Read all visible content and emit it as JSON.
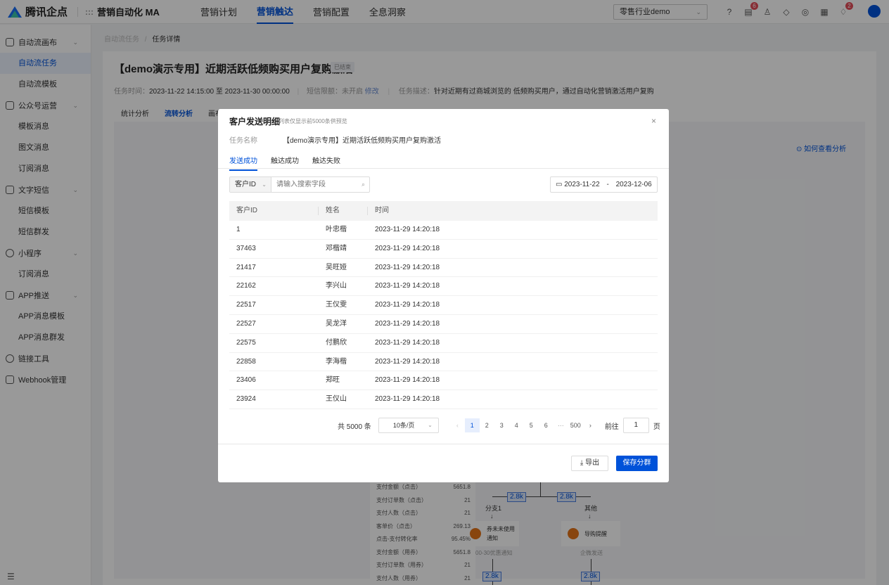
{
  "app": {
    "logo_text": "腾讯企点",
    "product": "营销自动化 MA",
    "grid_glyph": ":::"
  },
  "topnav": [
    {
      "label": "营销计划",
      "active": false
    },
    {
      "label": "营销触达",
      "active": true
    },
    {
      "label": "营销配置",
      "active": false
    },
    {
      "label": "全息洞察",
      "active": false
    }
  ],
  "industry_select": {
    "value": "零售行业demo"
  },
  "top_icons": [
    {
      "icon": "help-icon",
      "badge": ""
    },
    {
      "icon": "document-icon",
      "badge": "6"
    },
    {
      "icon": "user-icon",
      "badge": ""
    },
    {
      "icon": "shield-icon",
      "badge": ""
    },
    {
      "icon": "compass-icon",
      "badge": ""
    },
    {
      "icon": "report-icon",
      "badge": ""
    },
    {
      "icon": "bell-icon",
      "badge": "2"
    }
  ],
  "sidebar": {
    "groups": [
      {
        "label": "自动流画布",
        "items": [
          {
            "label": "自动流任务",
            "active": true
          },
          {
            "label": "自动流模板",
            "active": false
          }
        ]
      },
      {
        "label": "公众号运营",
        "items": [
          {
            "label": "模板消息"
          },
          {
            "label": "图文消息"
          },
          {
            "label": "订阅消息"
          }
        ]
      },
      {
        "label": "文字短信",
        "items": [
          {
            "label": "短信模板"
          },
          {
            "label": "短信群发"
          }
        ]
      },
      {
        "label": "小程序",
        "items": [
          {
            "label": "订阅消息"
          }
        ]
      },
      {
        "label": "APP推送",
        "items": [
          {
            "label": "APP消息模板"
          },
          {
            "label": "APP消息群发"
          }
        ]
      },
      {
        "label": "链接工具",
        "items": []
      },
      {
        "label": "Webhook管理",
        "items": []
      }
    ]
  },
  "breadcrumb": {
    "parent": "自动流任务",
    "sep": "/",
    "current": "任务详情"
  },
  "page": {
    "title": "【demo演示专用】近期活跃低频购买用户复购激活",
    "status": "已结束",
    "time_label": "任务时间：",
    "time_value": "2023-11-22 14:15:00 至 2023-11-30 00:00:00",
    "sms_label": "短信限额：",
    "sms_value": "未开启",
    "sms_link": "修改",
    "desc_label": "任务描述：",
    "desc_value": "针对近期有过商城浏览的 低频购买用户，通过自动化营销激活用户复购",
    "tabs": [
      {
        "label": "统计分析",
        "active": false
      },
      {
        "label": "流转分析",
        "active": true
      },
      {
        "label": "画布",
        "active": false
      }
    ],
    "howto": "如何查看分析"
  },
  "background_flow": {
    "stats": [
      {
        "label": "支付金额（点击）",
        "value": "5651.8"
      },
      {
        "label": "支付订单数（点击）",
        "value": "21"
      },
      {
        "label": "支付人数（点击）",
        "value": "21"
      },
      {
        "label": "客单价（点击）",
        "value": "269.13"
      },
      {
        "label": "点击-支付转化率",
        "value": "95.45%"
      },
      {
        "label": "支付金额（用券）",
        "value": "5651.8"
      },
      {
        "label": "支付订单数（用券）",
        "value": "21"
      },
      {
        "label": "支付人数（用券）",
        "value": "21"
      }
    ],
    "tags": [
      "2.8k",
      "2.8k",
      "2.8k",
      "2.8k"
    ],
    "branch1": "分支1",
    "branch2": "其他",
    "node1": "券未未使用通知",
    "node1_sub": "00-30优惠通知",
    "node2": "导购提醒",
    "node2_sub": "企微发送"
  },
  "modal": {
    "title": "客户发送明细",
    "subtitle": "列表仅显示前5000条供预览",
    "task_label": "任务名称",
    "task_value": "【demo演示专用】近期活跃低频购买用户复购激活",
    "tabs": [
      {
        "label": "发送成功",
        "active": true
      },
      {
        "label": "触达成功",
        "active": false
      },
      {
        "label": "触达失败",
        "active": false
      }
    ],
    "search": {
      "field": "客户ID",
      "placeholder": "请输入搜索字段"
    },
    "date_range": {
      "start": "2023-11-22",
      "sep": "-",
      "end": "2023-12-06"
    },
    "columns": [
      "客户ID",
      "姓名",
      "时间"
    ],
    "rows": [
      {
        "id": "1",
        "name": "叶忠楷",
        "time": "2023-11-29 14:20:18"
      },
      {
        "id": "37463",
        "name": "邓楷靖",
        "time": "2023-11-29 14:20:18"
      },
      {
        "id": "21417",
        "name": "吴旺娅",
        "time": "2023-11-29 14:20:18"
      },
      {
        "id": "22162",
        "name": "李兴山",
        "time": "2023-11-29 14:20:18"
      },
      {
        "id": "22517",
        "name": "王仪雯",
        "time": "2023-11-29 14:20:18"
      },
      {
        "id": "22527",
        "name": "吴龙洋",
        "time": "2023-11-29 14:20:18"
      },
      {
        "id": "22575",
        "name": "付鹏欣",
        "time": "2023-11-29 14:20:18"
      },
      {
        "id": "22858",
        "name": "李海楷",
        "time": "2023-11-29 14:20:18"
      },
      {
        "id": "23406",
        "name": "郑旺",
        "time": "2023-11-29 14:20:18"
      },
      {
        "id": "23924",
        "name": "王仪山",
        "time": "2023-11-29 14:20:18"
      }
    ],
    "pagination": {
      "total": "共 5000 条",
      "page_size": "10条/页",
      "prev": "‹",
      "pages": [
        "1",
        "2",
        "3",
        "4",
        "5",
        "6",
        "···",
        "500"
      ],
      "current": "1",
      "next": "›",
      "goto_label": "前往",
      "goto_value": "1",
      "goto_unit": "页"
    },
    "export_label": "导出",
    "save_label": "保存分群",
    "close_glyph": "×"
  },
  "colors": {
    "primary": "#0052d9",
    "badge": "#e34d59",
    "mask": "rgba(0,0,0,0.4)"
  }
}
